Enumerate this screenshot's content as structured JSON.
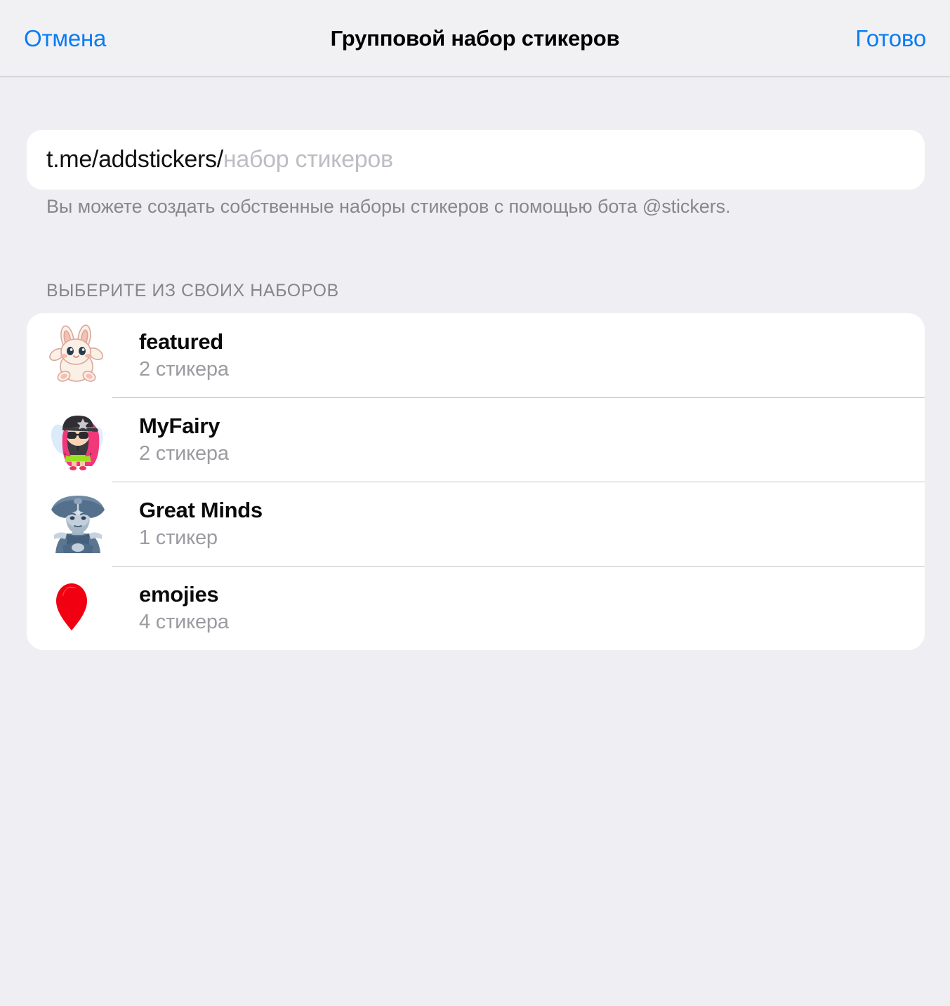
{
  "navbar": {
    "cancel_label": "Отмена",
    "title": "Групповой набор стикеров",
    "done_label": "Готово",
    "accent_color": "#0A7CF4"
  },
  "url_field": {
    "prefix": "t.me/addstickers/",
    "placeholder": "набор стикеров",
    "value": ""
  },
  "footnote": "Вы можете создать собственные наборы стикеров с помощью бота @stickers.",
  "section": {
    "header": "ВЫБЕРИТЕ ИЗ СВОИХ НАБОРОВ"
  },
  "sticker_sets": [
    {
      "title": "featured",
      "count": "2 стикера",
      "icon": "bunny-sticker"
    },
    {
      "title": "MyFairy",
      "count": "2 стикера",
      "icon": "fairy-girl-sticker"
    },
    {
      "title": "Great Minds",
      "count": "1 стикер",
      "icon": "napoleon-sticker"
    },
    {
      "title": "emojies",
      "count": "4 стикера",
      "icon": "red-balloon-sticker"
    }
  ]
}
